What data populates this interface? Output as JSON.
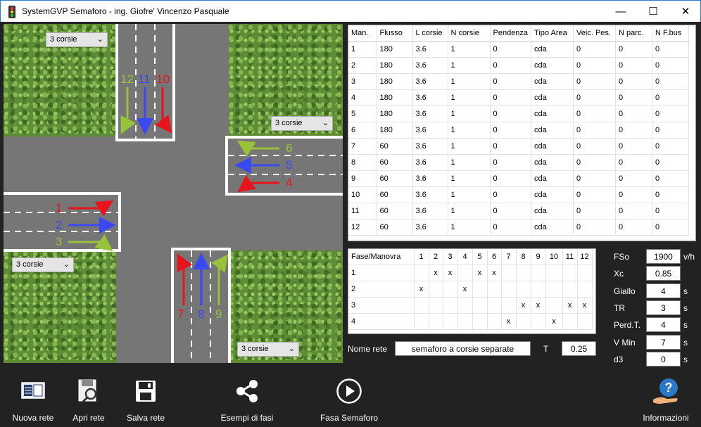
{
  "window": {
    "title": "SystemGVP Semaforo - ing. Giofre' Vincenzo Pasquale",
    "minimize_glyph": "—",
    "maximize_glyph": "☐",
    "close_glyph": "✕"
  },
  "intersection": {
    "combos": {
      "north": "3 corsie",
      "east": "3 corsie",
      "west": "3 corsie",
      "south": "3 corsie"
    },
    "arrow_numbers": {
      "n12": "12",
      "n11": "11",
      "n10": "10",
      "n6": "6",
      "n5": "5",
      "n4": "4",
      "n1": "1",
      "n2": "2",
      "n3": "3",
      "n7": "7",
      "n8": "8",
      "n9": "9"
    },
    "colors": {
      "left": "#e8141c",
      "straight": "#3a4af0",
      "right": "#98c23a"
    }
  },
  "manovre": {
    "headers": [
      "Man.",
      "Flusso",
      "L corsie",
      "N corsie",
      "Pendenza",
      "Tipo Area",
      "Veic. Pes.",
      "N parc.",
      "N F.bus"
    ],
    "rows": [
      [
        "1",
        "180",
        "3.6",
        "1",
        "0",
        "cda",
        "0",
        "0",
        "0"
      ],
      [
        "2",
        "180",
        "3.6",
        "1",
        "0",
        "cda",
        "0",
        "0",
        "0"
      ],
      [
        "3",
        "180",
        "3.6",
        "1",
        "0",
        "cda",
        "0",
        "0",
        "0"
      ],
      [
        "4",
        "180",
        "3.6",
        "1",
        "0",
        "cda",
        "0",
        "0",
        "0"
      ],
      [
        "5",
        "180",
        "3.6",
        "1",
        "0",
        "cda",
        "0",
        "0",
        "0"
      ],
      [
        "6",
        "180",
        "3.6",
        "1",
        "0",
        "cda",
        "0",
        "0",
        "0"
      ],
      [
        "7",
        "60",
        "3.6",
        "1",
        "0",
        "cda",
        "0",
        "0",
        "0"
      ],
      [
        "8",
        "60",
        "3.6",
        "1",
        "0",
        "cda",
        "0",
        "0",
        "0"
      ],
      [
        "9",
        "60",
        "3.6",
        "1",
        "0",
        "cda",
        "0",
        "0",
        "0"
      ],
      [
        "10",
        "60",
        "3.6",
        "1",
        "0",
        "cda",
        "0",
        "0",
        "0"
      ],
      [
        "11",
        "60",
        "3.6",
        "1",
        "0",
        "cda",
        "0",
        "0",
        "0"
      ],
      [
        "12",
        "60",
        "3.6",
        "1",
        "0",
        "cda",
        "0",
        "0",
        "0"
      ]
    ]
  },
  "fasi": {
    "headers": [
      "Fase/Manovra",
      "1",
      "2",
      "3",
      "4",
      "5",
      "6",
      "7",
      "8",
      "9",
      "10",
      "11",
      "12"
    ],
    "rows": [
      [
        "1",
        "",
        "x",
        "x",
        "",
        "x",
        "x",
        "",
        "",
        "",
        "",
        "",
        ""
      ],
      [
        "2",
        "x",
        "",
        "",
        "x",
        "",
        "",
        "",
        "",
        "",
        "",
        "",
        ""
      ],
      [
        "3",
        "",
        "",
        "",
        "",
        "",
        "",
        "",
        "x",
        "x",
        "",
        "x",
        "x"
      ],
      [
        "4",
        "",
        "",
        "",
        "",
        "",
        "",
        "x",
        "",
        "",
        "x",
        "",
        ""
      ]
    ]
  },
  "network": {
    "name_label": "Nome rete",
    "name_value": "semaforo a corsie separate",
    "t_label": "T",
    "t_value": "0.25"
  },
  "params": [
    {
      "label": "FSo",
      "value": "1900",
      "unit": "v/h"
    },
    {
      "label": "Xc",
      "value": "0.85",
      "unit": ""
    },
    {
      "label": "Giallo",
      "value": "4",
      "unit": "s"
    },
    {
      "label": "TR",
      "value": "3",
      "unit": "s"
    },
    {
      "label": "Perd.T.",
      "value": "4",
      "unit": "s"
    },
    {
      "label": "V Min",
      "value": "7",
      "unit": "s"
    },
    {
      "label": "d3",
      "value": "0",
      "unit": "s"
    }
  ],
  "toolbar": {
    "nuova_rete": "Nuova rete",
    "apri_rete": "Apri rete",
    "salva_rete": "Salva rete",
    "esempi_fasi": "Esempi di fasi",
    "fasa_semaforo": "Fasa Semaforo",
    "informazioni": "Informazioni"
  }
}
